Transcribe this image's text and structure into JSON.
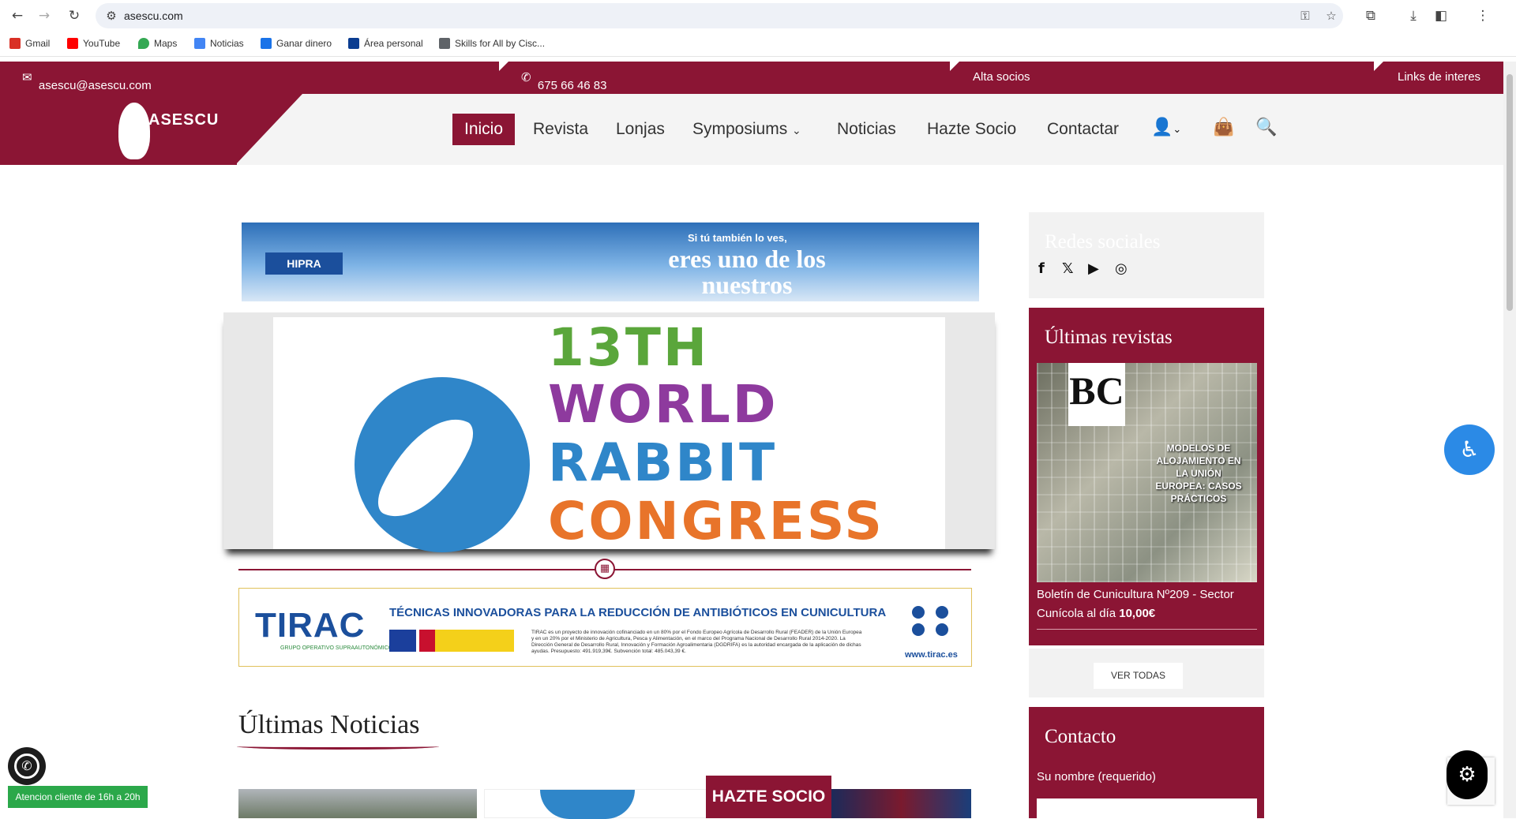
{
  "browser": {
    "url": "asescu.com",
    "bookmarks": [
      {
        "label": "Gmail",
        "color": "#d93025"
      },
      {
        "label": "YouTube",
        "color": "#ff0000"
      },
      {
        "label": "Maps",
        "color": "#34a853"
      },
      {
        "label": "Noticias",
        "color": "#4285f4"
      },
      {
        "label": "Ganar dinero",
        "color": "#1a73e8"
      },
      {
        "label": "Área personal",
        "color": "#0b3d91"
      },
      {
        "label": "Skills for All by Cisc...",
        "color": "#5f6368"
      }
    ]
  },
  "topbar": {
    "email": "asescu@asescu.com",
    "phone": "675 66 46 83",
    "alta": "Alta socios",
    "links": "Links de interes"
  },
  "logo": {
    "text": "ASESCU"
  },
  "nav": {
    "items": [
      "Inicio",
      "Revista",
      "Lonjas",
      "Symposiums",
      "Noticias",
      "Hazte Socio",
      "Contactar"
    ]
  },
  "banners": {
    "hipra_logo": "HIPRA",
    "hipra_small": "Si tú también lo ves,",
    "hipra_big": "eres uno de los nuestros",
    "congress_lines": [
      "13TH",
      "WORLD",
      "RABBIT",
      "CONGRESS"
    ],
    "tirac_logo": "TIRAC",
    "tirac_sub": "GRUPO OPERATIVO SUPRAAUTONÓMICO",
    "tirac_title": "TÉCNICAS INNOVADORAS PARA LA REDUCCIÓN DE ANTIBIÓTICOS EN CUNICULTURA",
    "tirac_small": "TIRAC es un proyecto de innovación cofinanciado en un 80% por el Fondo Europeo Agrícola de Desarrollo Rural (FEADER) de la Unión Europea y en un 20% por el Ministerio de Agricultura, Pesca y Alimentación, en el marco del Programa Nacional de Desarrollo Rural 2014-2020. La Dirección General de Desarrollo Rural, Innovación y Formación Agroalimentaria (DGDRIFA) es la autoridad encargada de la aplicación de dichas ayudas. Presupuesto: 491.919,39€. Subvención total: 485.043,39 €.",
    "tirac_url": "www.tirac.es"
  },
  "news": {
    "title": "Últimas Noticias"
  },
  "hazte_socio": "HAZTE SOCIO",
  "sidebar": {
    "redes_title": "Redes sociales",
    "revistas_title": "Últimas revistas",
    "cover_logo": "BC",
    "cover_text": "MODELOS DE ALOJAMIENTO EN LA UNIÓN EUROPEA: CASOS PRÁCTICOS",
    "revista_caption": "Boletín de Cunicultura Nº209 - Sector Cunícola al día",
    "revista_price": "10,00€",
    "ver_todas": "VER TODAS",
    "contacto_title": "Contacto",
    "nombre_label": "Su nombre (requerido)"
  },
  "whatsapp": {
    "label": "Atencion cliente de 16h a 20h"
  }
}
